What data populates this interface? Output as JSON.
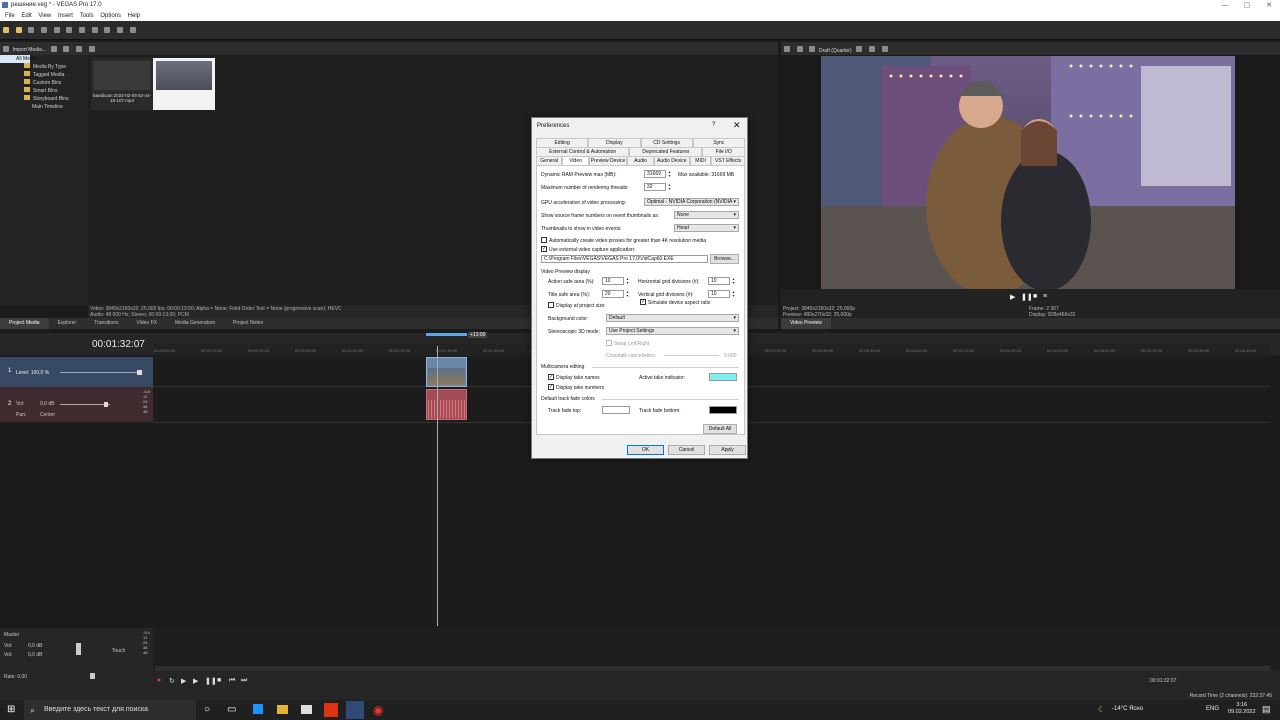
{
  "window": {
    "title": "решение.veg * - VEGAS Pro 17.0",
    "controls": [
      "—",
      "▢",
      "✕"
    ]
  },
  "menu": [
    "File",
    "Edit",
    "View",
    "Insert",
    "Tools",
    "Options",
    "Help"
  ],
  "project_media": {
    "toolbar_label": "Import Media...",
    "tree": [
      "All Media",
      "Media By Type",
      "Tagged Media",
      "Custom Bins",
      "Smart Bins",
      "Storyboard Bins",
      "Main Timeline"
    ],
    "items": [
      {
        "label": "bandicam 2022-02-09 02-44-18-107.mp4"
      },
      {
        "label": ""
      }
    ],
    "status_line1": "Video: 3840x2160x32; 25,000 fps; 00:00:13:00; Alpha = None; Field Order Test = None (progressive scan); HEVC",
    "status_line2": "Audio: 48 000 Hz; Stereo; 00:00:13:00; PCM",
    "tabs": [
      "Project Media",
      "Explorer",
      "Transitions",
      "Video FX",
      "Media Generators",
      "Project Notes"
    ]
  },
  "preview": {
    "quality": "Draft (Quarter)",
    "project": "Project:  3840x2160x32; 25,000p",
    "preview": "Preview:  480x270x32; 25,000p",
    "frame": "Frame:       2 307",
    "display": "Display:     828x466x32",
    "tab": "Video Preview"
  },
  "timeline": {
    "time": "00:01:32:07",
    "region": "+13:00",
    "ticks": [
      "00:00:00:00",
      "00:00:15:00",
      "00:00:30:00",
      "00:00:45:00",
      "00:01:00:00",
      "00:01:15:00",
      "00:01:30:00",
      "00:01:45:00",
      "00:02:00:00",
      "00:02:15:00",
      "00:02:30:00",
      "00:02:45:00",
      "00:03:00:00",
      "00:03:15:00",
      "00:03:30:00",
      "00:03:45:00",
      "00:04:00:00",
      "00:04:15:00",
      "00:04:30:00",
      "00:04:45:00",
      "00:05:00:00",
      "00:05:15:00",
      "00:05:30:00",
      "00:05:45:00"
    ],
    "video_track": {
      "num": "1",
      "level": "Level: 100,0 %"
    },
    "audio_track": {
      "num": "2",
      "vol": "Vol:",
      "vol_val": "0,0 dB",
      "pan": "Pan:",
      "pan_val": "Center",
      "meter": [
        "-5,8",
        "12",
        "24",
        "36",
        "48"
      ]
    },
    "master": {
      "label": "Master",
      "vol1": "Vol:",
      "v1": "0,0 dB",
      "vol2": "Vol:",
      "v2": "0,0 dB",
      "touch": "Touch",
      "meter": [
        "-5,4",
        "12",
        "24",
        "36",
        "48"
      ]
    },
    "rate": "Rate: 0,00",
    "end_time": "00:01:32:07",
    "record": "Record Time (2 channels): 232:37:45"
  },
  "dialog": {
    "title": "Preferences",
    "help": "?",
    "close": "✕",
    "tabs_row1": [
      "Editing",
      "Display",
      "CD Settings",
      "Sync"
    ],
    "tabs_row2": [
      "External Control & Automation",
      "Deprecated Features",
      "File I/O"
    ],
    "tabs_row3": [
      "General",
      "Video",
      "Preview Device",
      "Audio",
      "Audio Device",
      "MIDI",
      "VST Effects"
    ],
    "ram_label": "Dynamic RAM Preview max (MB):",
    "ram_value": "31669",
    "ram_max": "Max available: 31669 MB",
    "threads_label": "Maximum number of rendering threads:",
    "threads_value": "32",
    "gpu_label": "GPU acceleration of video processing:",
    "gpu_value": "Optimal - NVIDIA Corporation (NVIDIA",
    "frames_label": "Show source frame numbers on event thumbnails as:",
    "frames_value": "None",
    "thumbs_label": "Thumbnails to show in video events:",
    "thumbs_value": "Head",
    "auto_proxy": "Automatically create video proxies for greater than 4K resolution media",
    "ext_capture": "Use external video capture application:",
    "capture_path": "C:\\Program Files\\VEGAS\\VEGAS Pro 17.0\\VidCap60.EXE",
    "browse": "Browse...",
    "vpd_header": "Video Preview display",
    "action_label": "Action safe area (%):",
    "action_value": "10",
    "title_label": "Title safe area (%):",
    "title_value": "20",
    "hgrid_label": "Horizontal grid divisions (#):",
    "hgrid_value": "10",
    "vgrid_label": "Vertical grid divisions (#):",
    "vgrid_value": "10",
    "display_pixel": "Display at project size",
    "simulate": "Simulate device aspect ratio",
    "bg_label": "Background color:",
    "bg_value": "Default",
    "stereo_label": "Stereoscopic 3D mode:",
    "stereo_value": "Use Project Settings",
    "swap": "Swap Left/Right",
    "crosstalk": "Crosstalk cancellation:",
    "crosstalk_value": "0.000",
    "multicam_header": "Multicamera editing",
    "take_names": "Display take names",
    "take_numbers": "Display take numbers",
    "active_take": "Active take indicator:",
    "fade_header": "Default track fade colors",
    "fade_top": "Track fade top:",
    "fade_bottom": "Track fade bottom:",
    "default_all": "Default All",
    "ok": "OK",
    "cancel": "Cancel",
    "apply": "Apply",
    "colors": {
      "active_take": "#7ff0f0",
      "fade_top": "#ffffff",
      "fade_bottom": "#000000"
    }
  },
  "taskbar": {
    "search": "Введите здесь текст для поиска",
    "weather": "-14°C  Ясно",
    "lang": "ENG",
    "time": "3:16",
    "date": "09.02.2022"
  }
}
